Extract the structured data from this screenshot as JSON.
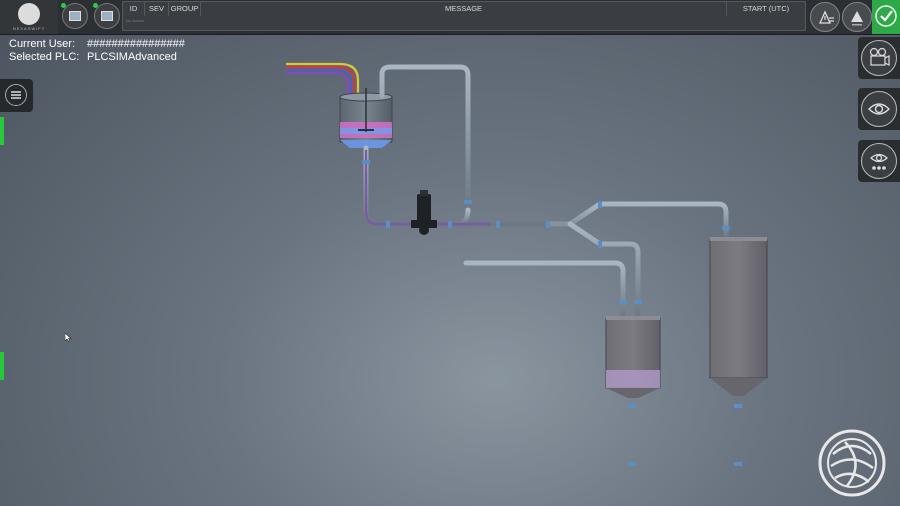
{
  "topbar": {
    "logo_text": "NEXASWIFT",
    "alarm_table": {
      "columns": [
        "ID",
        "SEV",
        "GROUP",
        "MESSAGE",
        "START (UTC)"
      ],
      "placeholder": "No alarms"
    }
  },
  "user": {
    "current_user_label": "Current User:",
    "current_user_value": "################",
    "selected_plc_label": "Selected PLC:",
    "selected_plc_value": "PLCSIMAdvanced"
  },
  "icons": {
    "plc_1": "plc-monitor-icon",
    "plc_2": "plc-monitor-icon",
    "ack": "alarm-list-icon",
    "escalate": "alarm-up-icon",
    "ok": "checkmark-icon",
    "menu": "hamburger-menu-icon",
    "camera": "video-camera-icon",
    "view": "eye-icon",
    "view_settings": "eye-settings-icon"
  },
  "colors": {
    "ok_green": "#2fa84a",
    "status_strip": "#28c83c"
  }
}
